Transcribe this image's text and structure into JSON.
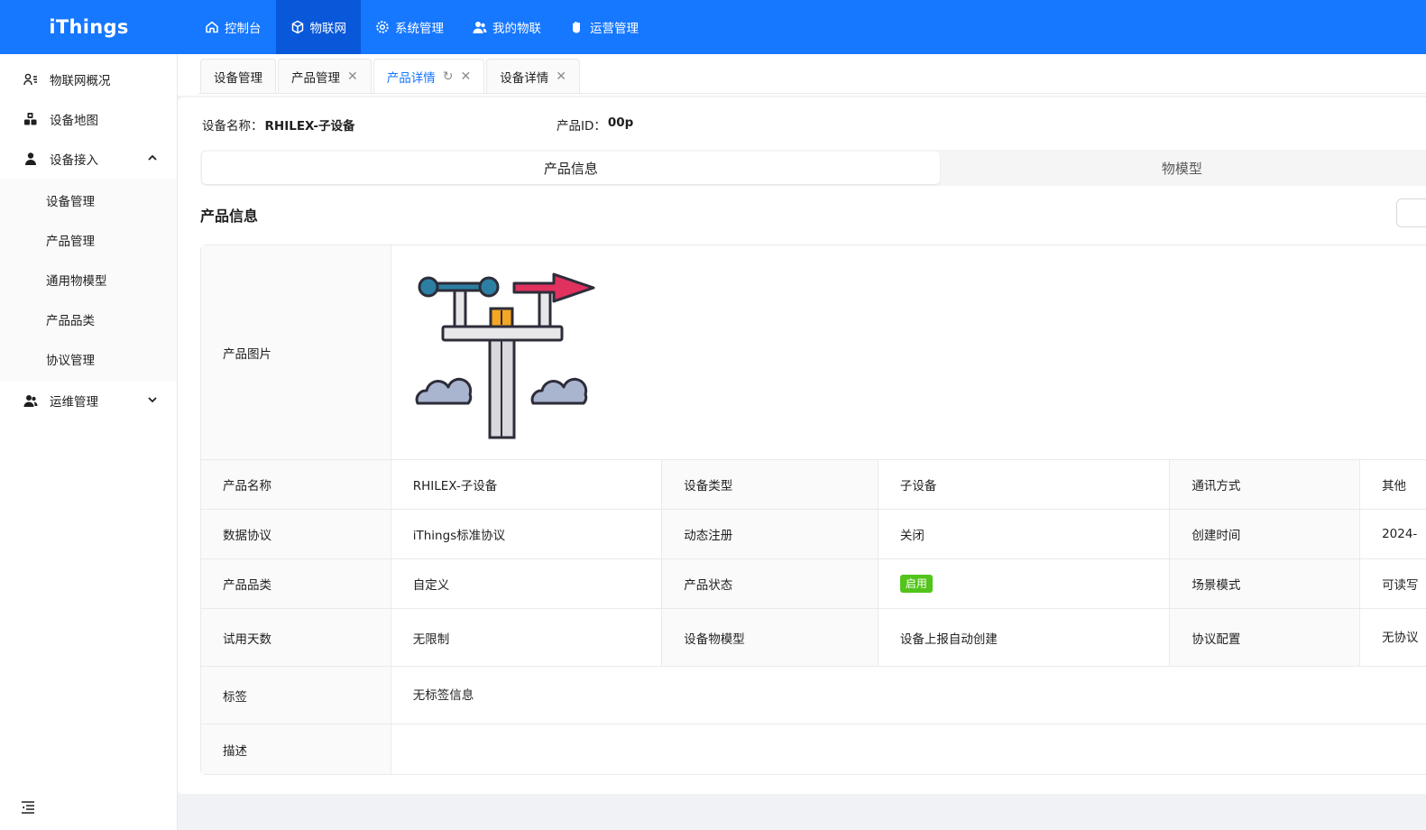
{
  "app": {
    "logo": "iThings"
  },
  "topnav": [
    {
      "label": "控制台",
      "icon": "home-icon",
      "active": false
    },
    {
      "label": "物联网",
      "icon": "cube-icon",
      "active": true
    },
    {
      "label": "系统管理",
      "icon": "gear-icon",
      "active": false
    },
    {
      "label": "我的物联",
      "icon": "users-icon",
      "active": false
    },
    {
      "label": "运营管理",
      "icon": "hand-icon",
      "active": false
    }
  ],
  "sidebar": {
    "items": [
      {
        "label": "物联网概况",
        "icon": "user-list-icon"
      },
      {
        "label": "设备地图",
        "icon": "boxes-icon"
      },
      {
        "label": "设备接入",
        "icon": "user-icon",
        "expanded": true
      },
      {
        "label": "运维管理",
        "icon": "team-icon",
        "expanded": false
      }
    ],
    "sub_items": [
      "设备管理",
      "产品管理",
      "通用物模型",
      "产品品类",
      "协议管理"
    ]
  },
  "tabs": [
    {
      "label": "设备管理",
      "closable": false,
      "active": false
    },
    {
      "label": "产品管理",
      "closable": true,
      "active": false
    },
    {
      "label": "产品详情",
      "closable": true,
      "active": true
    },
    {
      "label": "设备详情",
      "closable": true,
      "active": false
    }
  ],
  "header": {
    "device_name_label": "设备名称：",
    "device_name": "RHILEX-子设备",
    "product_id_label": "产品ID：",
    "product_id": "00p"
  },
  "segments": [
    "产品信息",
    "物模型"
  ],
  "section_title": "产品信息",
  "product": {
    "image_label": "产品图片",
    "name_label": "产品名称",
    "name": "RHILEX-子设备",
    "device_type_label": "设备类型",
    "device_type": "子设备",
    "comm_label": "通讯方式",
    "comm": "其他",
    "protocol_label": "数据协议",
    "protocol": "iThings标准协议",
    "dynamic_label": "动态注册",
    "dynamic": "关闭",
    "created_label": "创建时间",
    "created": "2024-",
    "category_label": "产品品类",
    "category": "自定义",
    "status_label": "产品状态",
    "status": "启用",
    "scene_label": "场景模式",
    "scene": "可读写",
    "trial_label": "试用天数",
    "trial": "无限制",
    "model_label": "设备物模型",
    "model": "设备上报自动创建",
    "proto_cfg_label": "协议配置",
    "proto_cfg": "无协议",
    "tags_label": "标签",
    "tags": "无标签信息",
    "desc_label": "描述",
    "desc": ""
  },
  "colors": {
    "primary": "#1677ff",
    "primary_dark": "#0958d9",
    "success": "#52c41a"
  }
}
